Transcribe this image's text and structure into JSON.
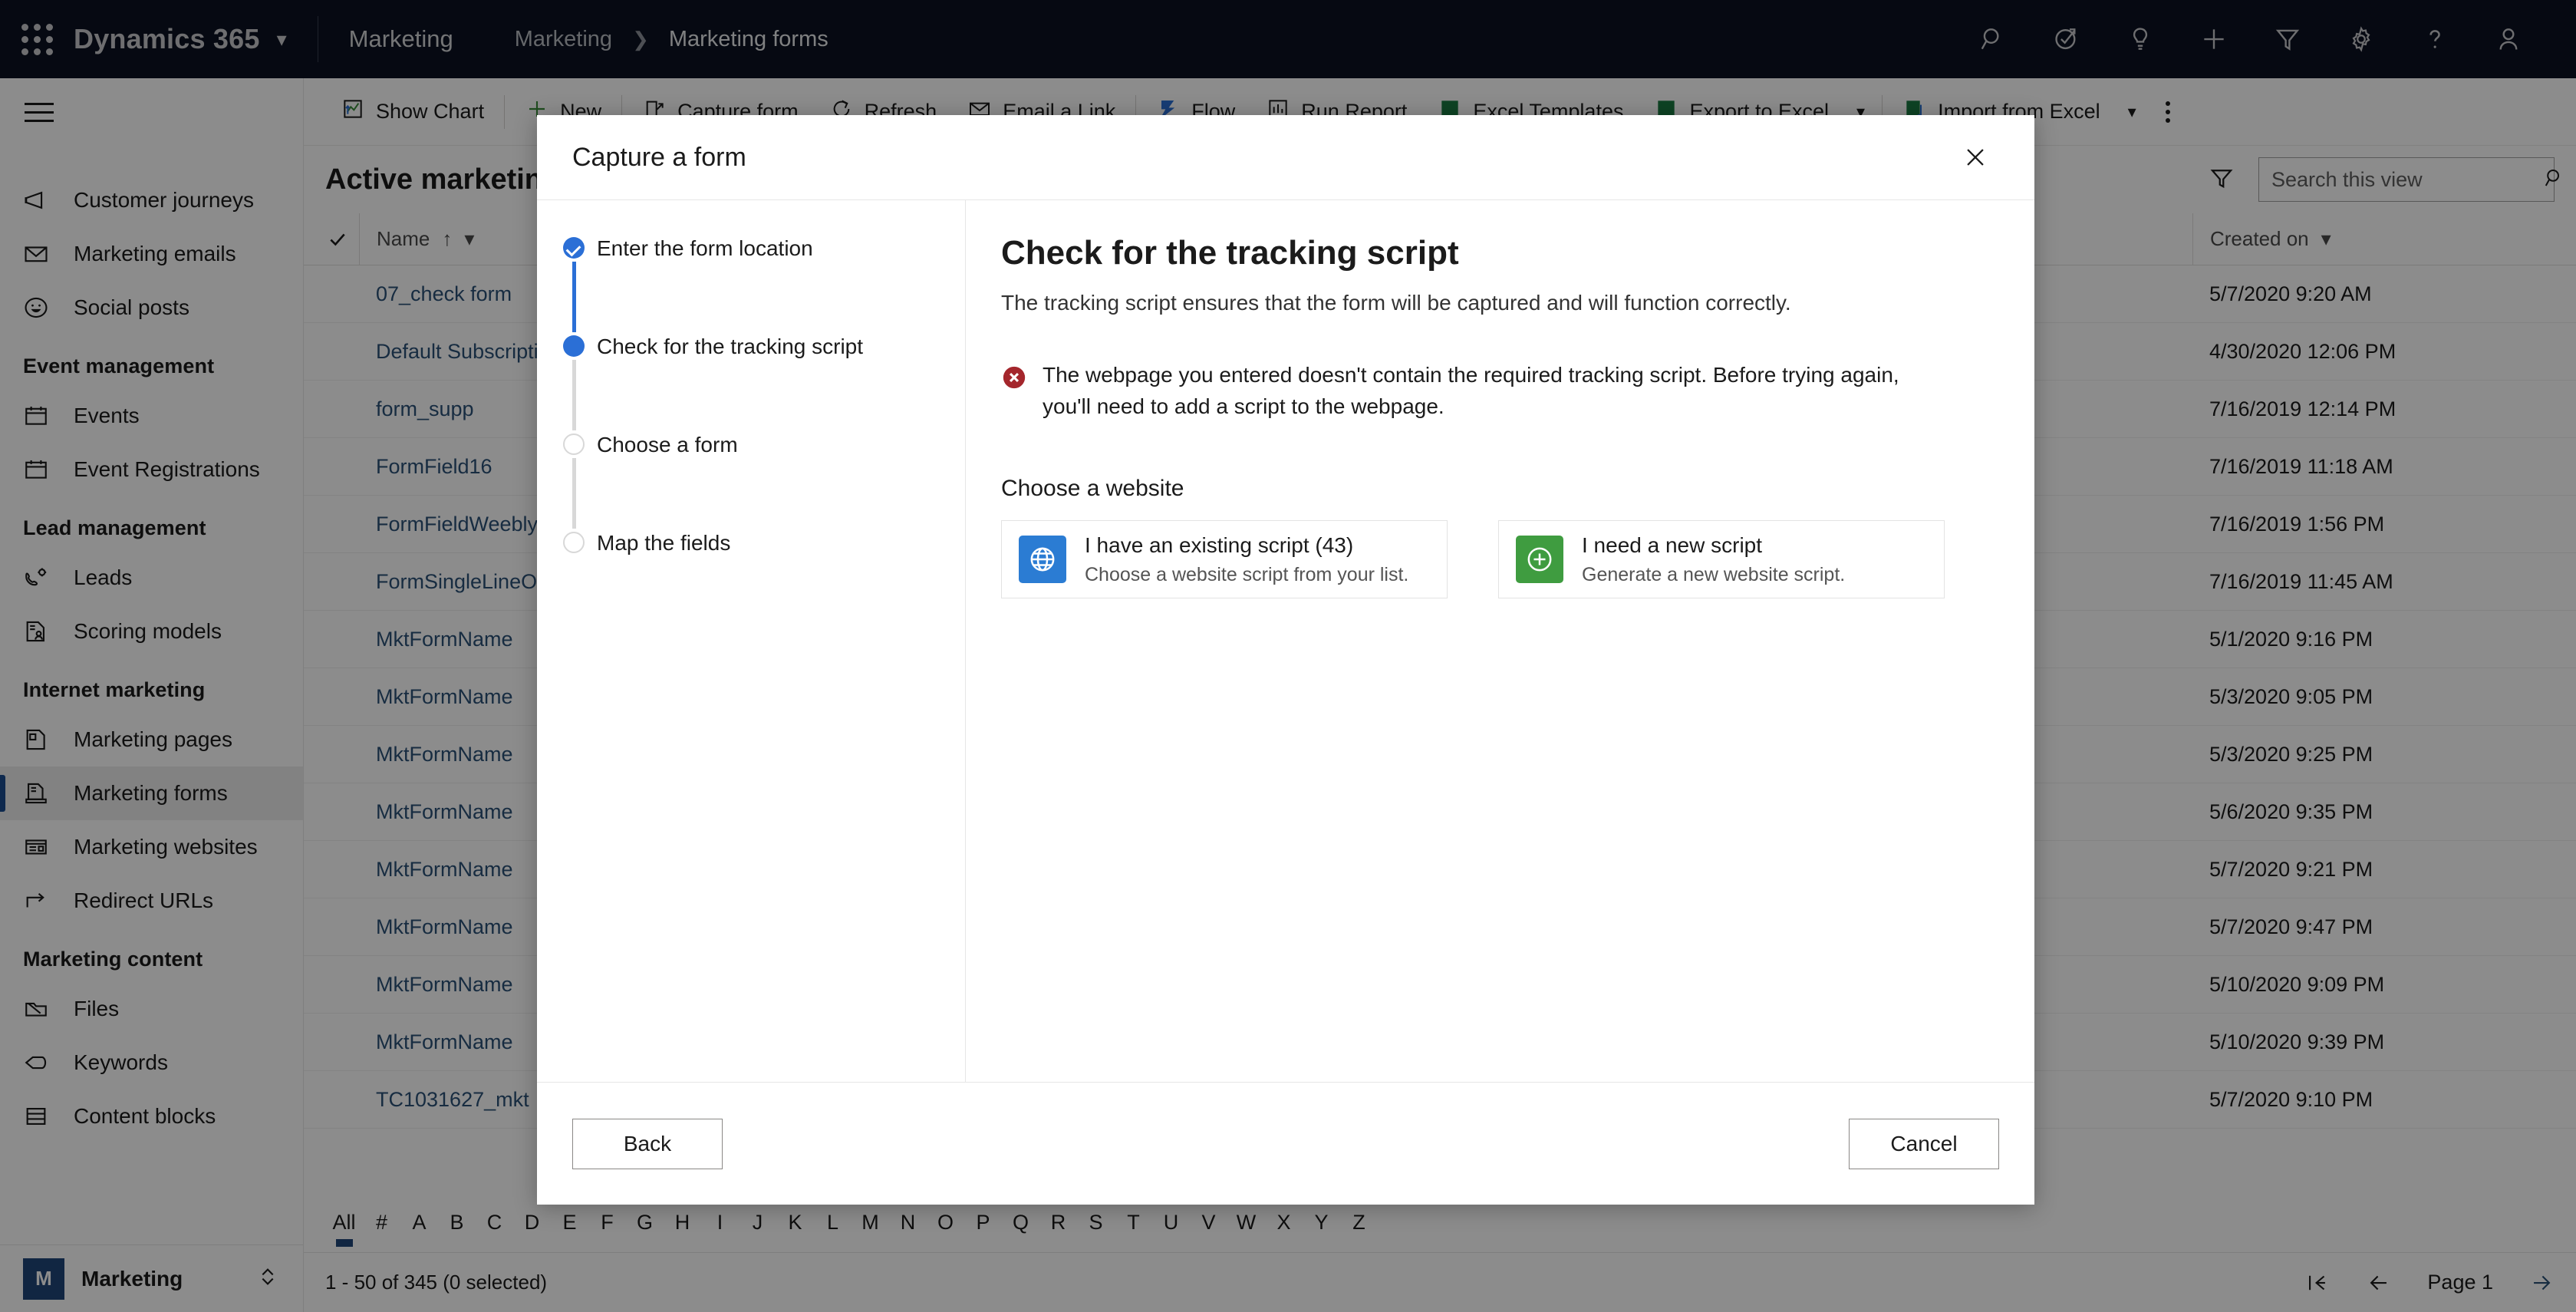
{
  "topnav": {
    "waffle_label": "app-launcher",
    "brand": "Dynamics 365",
    "app_name": "Marketing",
    "breadcrumbs": [
      "Marketing",
      "Marketing forms"
    ],
    "icons": [
      "search-icon",
      "assistant-icon",
      "lightbulb-icon",
      "plus-icon",
      "filter-icon",
      "gear-icon",
      "help-icon",
      "user-avatar-icon"
    ]
  },
  "sidebar": {
    "groups": [
      {
        "title": "",
        "items": [
          {
            "label": "Customer journeys",
            "icon": "megaphone-icon",
            "active": false
          },
          {
            "label": "Marketing emails",
            "icon": "envelope-icon",
            "active": false
          },
          {
            "label": "Social posts",
            "icon": "smiley-icon",
            "active": false
          }
        ]
      },
      {
        "title": "Event management",
        "items": [
          {
            "label": "Events",
            "icon": "calendar-icon",
            "active": false
          },
          {
            "label": "Event Registrations",
            "icon": "calendar-icon",
            "active": false
          }
        ]
      },
      {
        "title": "Lead management",
        "items": [
          {
            "label": "Leads",
            "icon": "phone-gear-icon",
            "active": false
          },
          {
            "label": "Scoring models",
            "icon": "document-person-icon",
            "active": false
          }
        ]
      },
      {
        "title": "Internet marketing",
        "items": [
          {
            "label": "Marketing pages",
            "icon": "page-icon",
            "active": false
          },
          {
            "label": "Marketing forms",
            "icon": "form-icon",
            "active": true
          },
          {
            "label": "Marketing websites",
            "icon": "website-icon",
            "active": false
          },
          {
            "label": "Redirect URLs",
            "icon": "redirect-arrow-icon",
            "active": false
          }
        ]
      },
      {
        "title": "Marketing content",
        "items": [
          {
            "label": "Files",
            "icon": "folder-icon",
            "active": false
          },
          {
            "label": "Keywords",
            "icon": "tag-icon",
            "active": false
          },
          {
            "label": "Content blocks",
            "icon": "blocks-icon",
            "active": false
          }
        ]
      }
    ],
    "footer": {
      "badge": "M",
      "label": "Marketing",
      "chevron": "area-switcher-icon"
    }
  },
  "commandbar": {
    "items": [
      {
        "label": "Show Chart",
        "icon": "chart-icon"
      },
      {
        "label": "New",
        "icon": "plus-icon"
      },
      {
        "label": "Capture form",
        "icon": "capture-icon"
      },
      {
        "label": "Refresh",
        "icon": "refresh-icon"
      },
      {
        "label": "Email a Link",
        "icon": "email-link-icon"
      },
      {
        "label": "Flow",
        "icon": "flow-icon"
      },
      {
        "label": "Run Report",
        "icon": "report-icon"
      },
      {
        "label": "Excel Templates",
        "icon": "excel-template-icon"
      },
      {
        "label": "Export to Excel",
        "icon": "excel-export-icon"
      },
      {
        "label": "Import from Excel",
        "icon": "excel-import-icon"
      }
    ],
    "overflow_label": "more-commands"
  },
  "viewbar": {
    "title": "Active marketing forms",
    "title_chevron": "chevron-down-icon",
    "filter_icon": "filter-icon",
    "search_placeholder": "Search this view",
    "search_value": "",
    "search_icon": "search-icon"
  },
  "grid": {
    "columns": [
      "Name",
      "Created on"
    ],
    "sort_indicator": "↑",
    "rows": [
      {
        "name": "07_check form",
        "created": "5/7/2020 9:20 AM"
      },
      {
        "name": "Default Subscription Center",
        "created": "4/30/2020 12:06 PM"
      },
      {
        "name": "form_supp",
        "created": "7/16/2019 12:14 PM"
      },
      {
        "name": "FormField16",
        "created": "7/16/2019 11:18 AM"
      },
      {
        "name": "FormFieldWeeblyForm",
        "created": "7/16/2019 1:56 PM"
      },
      {
        "name": "FormSingleLineOfText",
        "created": "7/16/2019 11:45 AM"
      },
      {
        "name": "MktFormName",
        "created": "5/1/2020 9:16 PM"
      },
      {
        "name": "MktFormName",
        "created": "5/3/2020 9:05 PM"
      },
      {
        "name": "MktFormName",
        "created": "5/3/2020 9:25 PM"
      },
      {
        "name": "MktFormName",
        "created": "5/6/2020 9:35 PM"
      },
      {
        "name": "MktFormName",
        "created": "5/7/2020 9:21 PM"
      },
      {
        "name": "MktFormName",
        "created": "5/7/2020 9:47 PM"
      },
      {
        "name": "MktFormName",
        "created": "5/10/2020 9:09 PM"
      },
      {
        "name": "MktFormName",
        "created": "5/10/2020 9:39 PM"
      },
      {
        "name": "TC1031627_mkt",
        "created": "5/7/2020 9:10 PM"
      }
    ]
  },
  "alphabar": {
    "letters": [
      "All",
      "#",
      "A",
      "B",
      "C",
      "D",
      "E",
      "F",
      "G",
      "H",
      "I",
      "J",
      "K",
      "L",
      "M",
      "N",
      "O",
      "P",
      "Q",
      "R",
      "S",
      "T",
      "U",
      "V",
      "W",
      "X",
      "Y",
      "Z"
    ],
    "active": "All"
  },
  "statusbar": {
    "record_count": "1 - 50 of 345 (0 selected)",
    "page_label": "Page 1",
    "first_page_icon": "first-page-icon",
    "prev_page_icon": "previous-page-icon",
    "next_page_icon": "next-page-icon"
  },
  "dialog": {
    "title": "Capture a form",
    "close_icon": "close-icon",
    "steps": [
      {
        "label": "Enter the form location",
        "state": "done"
      },
      {
        "label": "Check for the tracking script",
        "state": "current"
      },
      {
        "label": "Choose a form",
        "state": "todo"
      },
      {
        "label": "Map the fields",
        "state": "todo"
      }
    ],
    "heading": "Check for the tracking script",
    "subheading": "The tracking script ensures that the form will be captured and will function correctly.",
    "error": {
      "icon": "error-icon",
      "color": "#a4262c",
      "text": "The webpage you entered doesn't contain the required tracking script. Before trying again, you'll need to add a script to the webpage."
    },
    "choose_website_label": "Choose a website",
    "cards": [
      {
        "title": "I have an existing script (43)",
        "desc": "Choose a website script from your list.",
        "icon": "globe-icon",
        "color": "#2b7cd3"
      },
      {
        "title": "I need a new script",
        "desc": "Generate a new website script.",
        "icon": "plus-circle-icon",
        "color": "#3f9c40"
      }
    ],
    "back_label": "Back",
    "cancel_label": "Cancel"
  },
  "colors": {
    "nav_bg": "#0b1222",
    "accent": "#2b6fd6",
    "link": "#2b5177",
    "active_bar": "#1b4b8f"
  }
}
